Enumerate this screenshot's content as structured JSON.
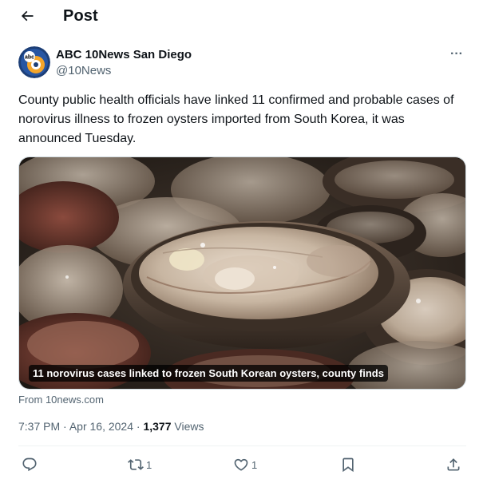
{
  "header": {
    "back_icon": "arrow-left-icon",
    "title": "Post"
  },
  "author": {
    "name": "ABC 10News San Diego",
    "handle": "@10News",
    "avatar_icon": "abc-logo-avatar",
    "avatar_text": "abc",
    "more_icon": "more-horizontal-icon",
    "more_label": "···"
  },
  "tweet": {
    "text": "County public health officials have linked 11 confirmed and probable cases of norovirus illness to frozen oysters imported from South Korea, it was announced Tuesday."
  },
  "media": {
    "caption": "11 norovirus cases linked to frozen South Korean oysters, county finds",
    "source": "From 10news.com"
  },
  "meta": {
    "time": "7:37 PM",
    "separator": "·",
    "date": "Apr 16, 2024",
    "views_count": "1,377",
    "views_label": "Views"
  },
  "actions": {
    "reply": {
      "icon": "reply-icon",
      "count": ""
    },
    "repost": {
      "icon": "repost-icon",
      "count": "1"
    },
    "like": {
      "icon": "heart-icon",
      "count": "1"
    },
    "bookmark": {
      "icon": "bookmark-icon",
      "count": ""
    },
    "share": {
      "icon": "share-icon",
      "count": ""
    }
  },
  "colors": {
    "text_primary": "#0f1419",
    "text_secondary": "#536471",
    "border": "#cfd9de",
    "caption_bg": "#000000"
  }
}
